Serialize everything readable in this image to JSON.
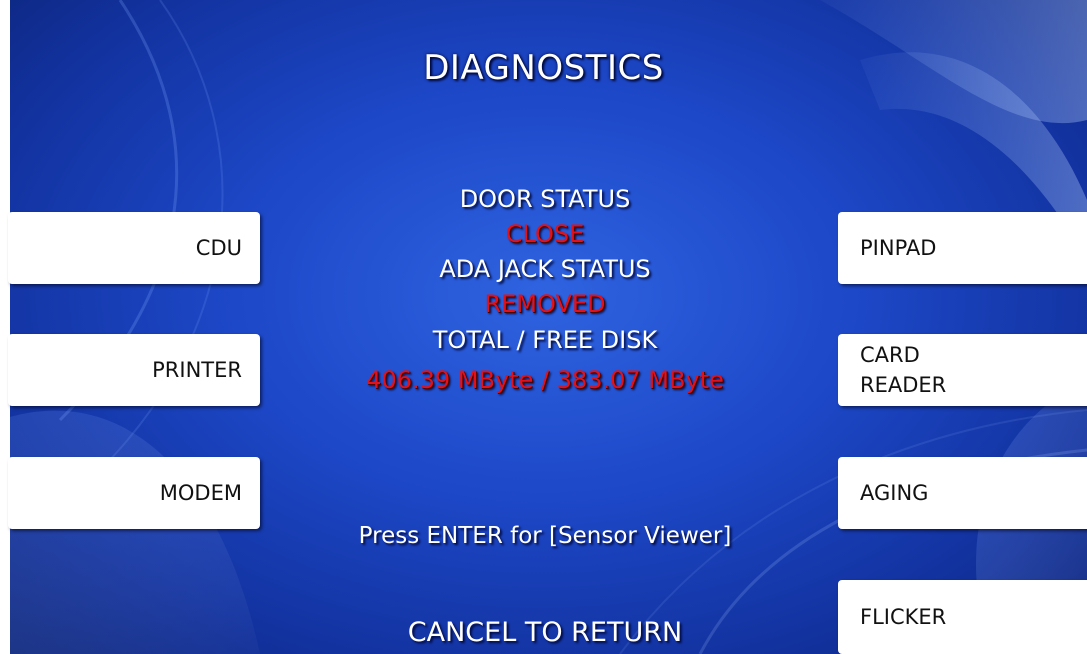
{
  "screen": {
    "title": "DIAGNOSTICS",
    "colors": {
      "background": "#1d48c8",
      "status_value": "#e0121b",
      "text": "#ffffff",
      "button": "#ffffff"
    }
  },
  "status": {
    "door_label": "DOOR STATUS",
    "door_value": "CLOSE",
    "ada_label": "ADA JACK STATUS",
    "ada_value": "REMOVED",
    "disk_label": "TOTAL / FREE DISK",
    "disk_value": "406.39 MByte / 383.07 MByte"
  },
  "left_buttons": {
    "cdu": "CDU",
    "printer": "PRINTER",
    "modem": "MODEM"
  },
  "right_buttons": {
    "pinpad": "PINPAD",
    "card_reader": "CARD\nREADER",
    "aging": "AGING",
    "flicker": "FLICKER"
  },
  "footer": {
    "hint": "Press ENTER for [Sensor Viewer]",
    "cancel": "CANCEL TO RETURN"
  }
}
